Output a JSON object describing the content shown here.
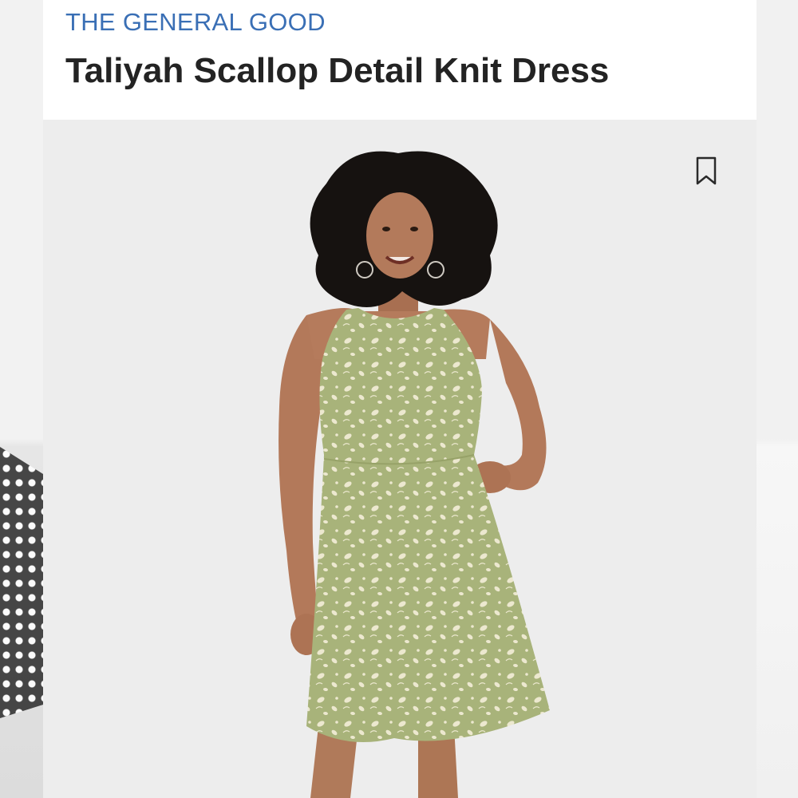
{
  "product": {
    "brand": "THE GENERAL GOOD",
    "title": "Taliyah Scallop Detail Knit Dress"
  },
  "colors": {
    "brand_text": "#3a6fb5",
    "title_text": "#232323",
    "image_background": "#ededed",
    "dress_base": "#a8b37a",
    "dress_print": "#ece8cf"
  },
  "icons": {
    "save": "bookmark-icon"
  }
}
